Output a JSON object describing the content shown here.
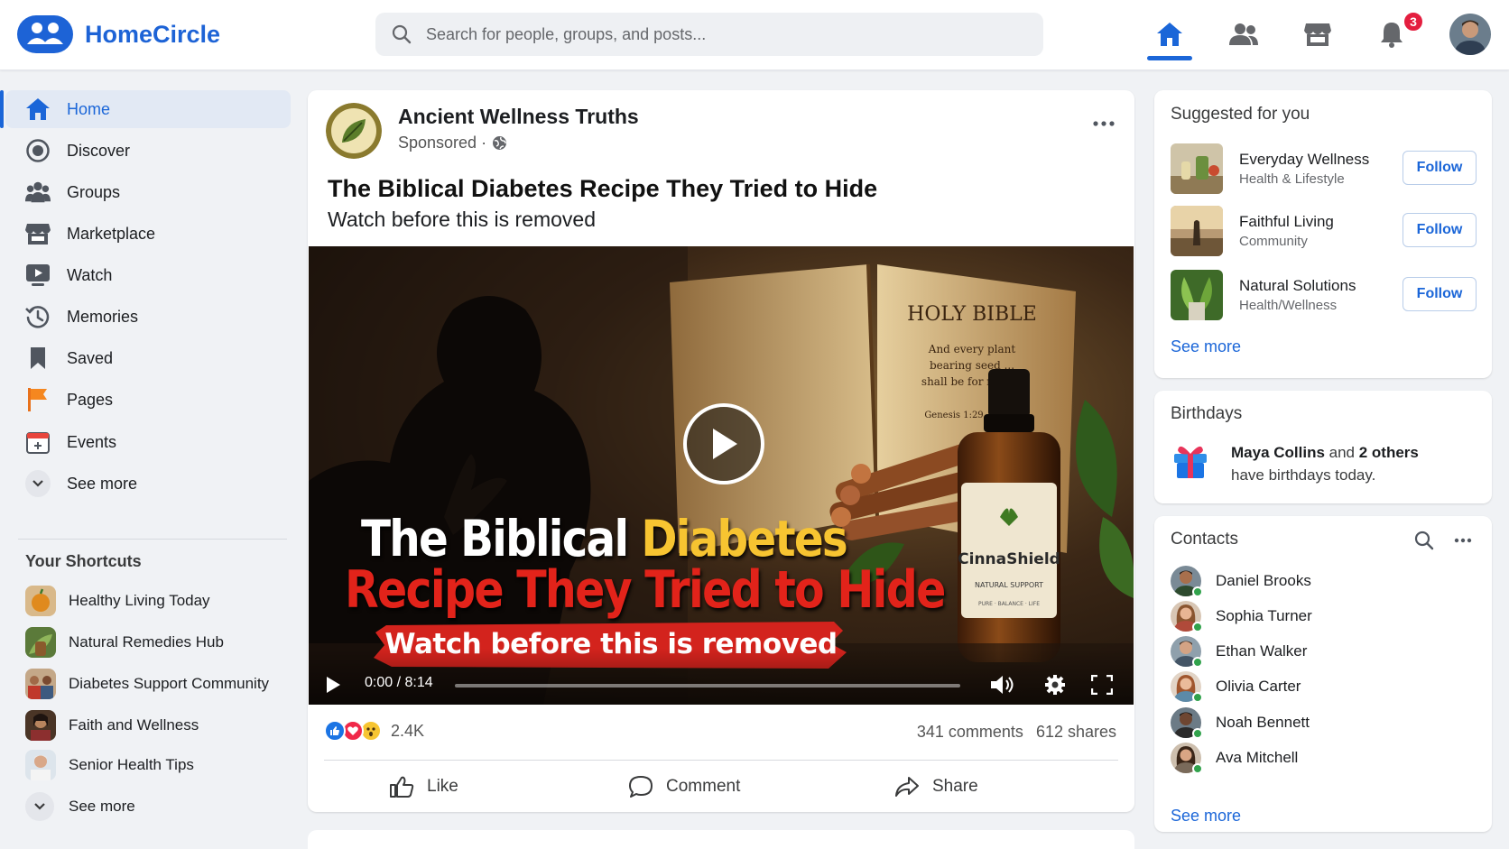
{
  "app": {
    "brand": "HomeCircle",
    "accent": "#1b66d8"
  },
  "search": {
    "placeholder": "Search for people, groups, and posts..."
  },
  "topnav": {
    "items": [
      {
        "icon": "home-icon",
        "active": true
      },
      {
        "icon": "friends-icon",
        "active": false
      },
      {
        "icon": "marketplace-icon",
        "active": false
      },
      {
        "icon": "bell-icon",
        "active": false
      }
    ],
    "notification_count": "3"
  },
  "sidebar": {
    "items": [
      {
        "label": "Home",
        "icon": "home-icon",
        "active": true
      },
      {
        "label": "Discover",
        "icon": "compass-icon"
      },
      {
        "label": "Groups",
        "icon": "groups-icon"
      },
      {
        "label": "Marketplace",
        "icon": "store-icon"
      },
      {
        "label": "Watch",
        "icon": "play-screen-icon"
      },
      {
        "label": "Memories",
        "icon": "clock-history-icon"
      },
      {
        "label": "Saved",
        "icon": "bookmark-icon"
      },
      {
        "label": "Pages",
        "icon": "flag-icon"
      },
      {
        "label": "Events",
        "icon": "calendar-icon"
      },
      {
        "label": "See more",
        "icon": "chevron-down-icon"
      }
    ],
    "shortcuts_title": "Your Shortcuts",
    "shortcuts": [
      {
        "label": "Healthy Living Today"
      },
      {
        "label": "Natural Remedies Hub"
      },
      {
        "label": "Diabetes Support Community"
      },
      {
        "label": "Faith and Wellness"
      },
      {
        "label": "Senior Health Tips"
      }
    ],
    "shortcuts_see_more": "See more"
  },
  "post": {
    "page_name": "Ancient Wellness Truths",
    "sponsored": "Sponsored ·",
    "title": "The Biblical Diabetes Recipe They Tried to Hide",
    "subtitle": "Watch before this is removed",
    "video": {
      "overlay_line1_a": "The Biblical ",
      "overlay_line1_b": "Diabetes",
      "overlay_line2": "Recipe They Tried to Hide",
      "overlay_banner": "Watch before this is removed",
      "book_title": "HOLY BIBLE",
      "book_verse_1": "And every plant",
      "book_verse_2": "bearing seed ...",
      "book_verse_3": "shall be for meat.\"",
      "book_ref": "Genesis 1:29",
      "bottle_brand": "CinnaShield",
      "bottle_sub": "NATURAL SUPPORT",
      "bottle_sub2": "PURE · BALANCE · LIFE",
      "time": "0:00 / 8:14",
      "progress": 0
    },
    "reactions": [
      "like",
      "love",
      "wow"
    ],
    "reaction_count": "2.4K",
    "comments": "341 comments",
    "shares": "612 shares",
    "actions": {
      "like": "Like",
      "comment": "Comment",
      "share": "Share"
    }
  },
  "suggested": {
    "title": "Suggested for you",
    "items": [
      {
        "name": "Everyday Wellness",
        "category": "Health & Lifestyle",
        "button": "Follow"
      },
      {
        "name": "Faithful Living",
        "category": "Community",
        "button": "Follow"
      },
      {
        "name": "Natural Solutions",
        "category": "Health/Wellness",
        "button": "Follow"
      }
    ],
    "see_more": "See more"
  },
  "birthdays": {
    "title": "Birthdays",
    "name": "Maya Collins",
    "and": " and ",
    "others": "2 others",
    "rest": "have birthdays today."
  },
  "contacts": {
    "title": "Contacts",
    "items": [
      {
        "name": "Daniel Brooks",
        "online": true
      },
      {
        "name": "Sophia Turner",
        "online": true
      },
      {
        "name": "Ethan Walker",
        "online": true
      },
      {
        "name": "Olivia Carter",
        "online": true
      },
      {
        "name": "Noah Bennett",
        "online": true
      },
      {
        "name": "Ava Mitchell",
        "online": true
      }
    ],
    "see_more": "See more"
  }
}
